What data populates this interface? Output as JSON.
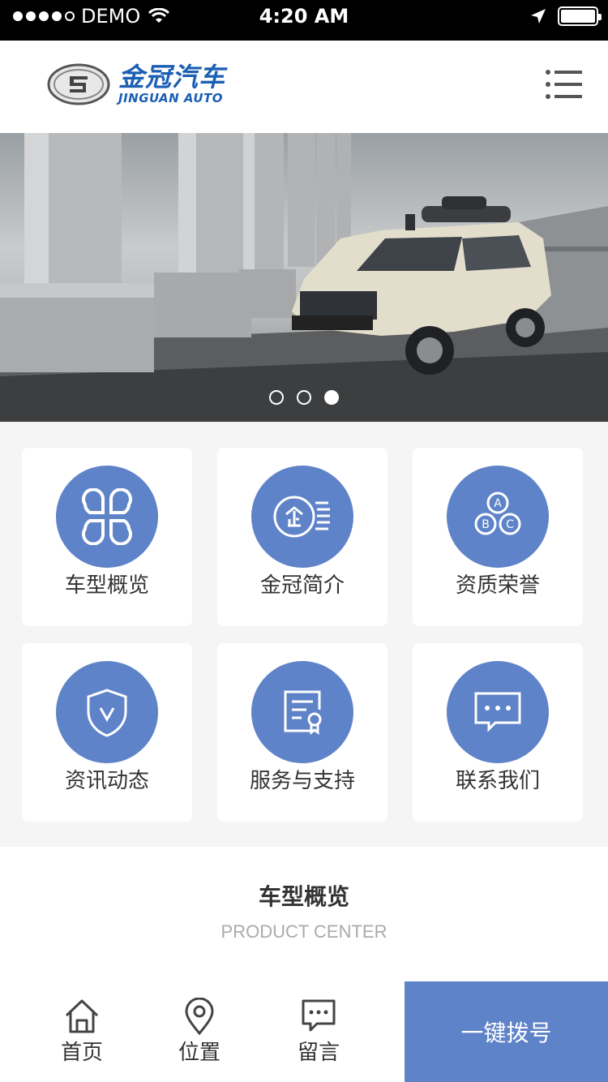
{
  "status_bar": {
    "carrier": "DEMO",
    "time": "4:20 AM"
  },
  "header": {
    "brand_cn": "金冠汽车",
    "brand_en": "JINGUAN AUTO"
  },
  "banner": {
    "slide_count": 3,
    "active_slide": 3
  },
  "menu": [
    {
      "label": "车型概览",
      "icon": "grid-icon"
    },
    {
      "label": "金冠简介",
      "icon": "company-icon"
    },
    {
      "label": "资质荣誉",
      "icon": "abc-icon"
    },
    {
      "label": "资讯动态",
      "icon": "shield-icon"
    },
    {
      "label": "服务与支持",
      "icon": "certificate-icon"
    },
    {
      "label": "联系我们",
      "icon": "message-icon"
    }
  ],
  "section": {
    "title": "车型概览",
    "subtitle": "PRODUCT CENTER"
  },
  "bottom_nav": {
    "home": "首页",
    "location": "位置",
    "message": "留言",
    "call": "一键拨号"
  },
  "colors": {
    "accent": "#5f83c8",
    "brand": "#1b5fb3"
  }
}
